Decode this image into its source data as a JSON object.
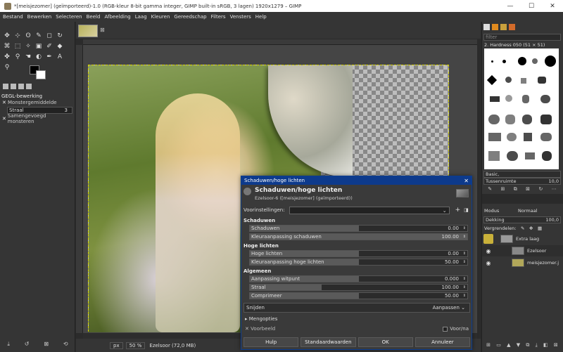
{
  "window": {
    "title": "*[meisjezomer] (geïmporteerd)-1.0 (RGB-kleur 8-bit gamma integer, GIMP built-in sRGB, 3 lagen) 1920x1279 – GIMP",
    "minimize": "—",
    "maximize": "☐",
    "close": "✕"
  },
  "menu": [
    "Bestand",
    "Bewerken",
    "Selecteren",
    "Beeld",
    "Afbeelding",
    "Laag",
    "Kleuren",
    "Gereedschap",
    "Filters",
    "Vensters",
    "Help"
  ],
  "tool_options": {
    "header": "GEGL-bewerking",
    "monster": "Monstergemiddelde",
    "straal_label": "Straal",
    "straal_value": "3",
    "samengevoegd": "Samengevoegd monsteren"
  },
  "image_tab": {
    "close": "⊠"
  },
  "statusbar": {
    "unit": "px",
    "zoom": "50 %",
    "info": "Ezelsoor (72,0 MB)"
  },
  "right_dock": {
    "filter_placeholder": "filter",
    "brush_name": "2. Hardness 050 (51 × 51)",
    "brush_set": "Basic,",
    "spacing_label": "Tussenruimte",
    "spacing_value": "10,0",
    "modus_label": "Modus",
    "modus_value": "Normaal",
    "opacity_label": "Dekking",
    "opacity_value": "100,0",
    "lock_label": "Vergrendelen:",
    "layers": [
      {
        "name": "Extra laag",
        "thumb": "#d4b83a"
      },
      {
        "name": "Ezelsoor",
        "thumb": "#8a8a8a"
      },
      {
        "name": "meisjezomer.j",
        "thumb": "#b2a85a"
      }
    ]
  },
  "dialog": {
    "title": "Schaduwen/hoge lichten",
    "heading": "Schaduwen/hoge lichten",
    "subheading": "Ezelsoor-6 ([meisjezomer] (geïmporteerd))",
    "presets_label": "Voorinstellingen:",
    "sections": {
      "shadows": "Schaduwen",
      "highlights": "Hoge lichten",
      "general": "Algemeen"
    },
    "sliders": [
      {
        "label": "Schaduwen",
        "value": "0.00",
        "fraction": 0.5
      },
      {
        "label": "Kleuraanpassing schaduwen",
        "value": "100.00",
        "fraction": 1.0
      },
      {
        "label": "Hoge lichten",
        "value": "0.00",
        "fraction": 0.5
      },
      {
        "label": "Kleuraanpassing hoge lichten",
        "value": "50.00",
        "fraction": 0.5
      },
      {
        "label": "Aanpassing witpunt",
        "value": "0.000",
        "fraction": 0.5
      },
      {
        "label": "Straal",
        "value": "100.00",
        "fraction": 0.33
      },
      {
        "label": "Comprimeer",
        "value": "50.00",
        "fraction": 0.5
      }
    ],
    "clip_label": "Snijden",
    "clip_value": "Aanpassen",
    "blend_label": "Mengopties",
    "preview_label": "Voorbeeld",
    "split_label": "Voor/na",
    "buttons": {
      "help": "Hulp",
      "defaults": "Standaardwaarden",
      "ok": "OK",
      "cancel": "Annuleer"
    }
  }
}
